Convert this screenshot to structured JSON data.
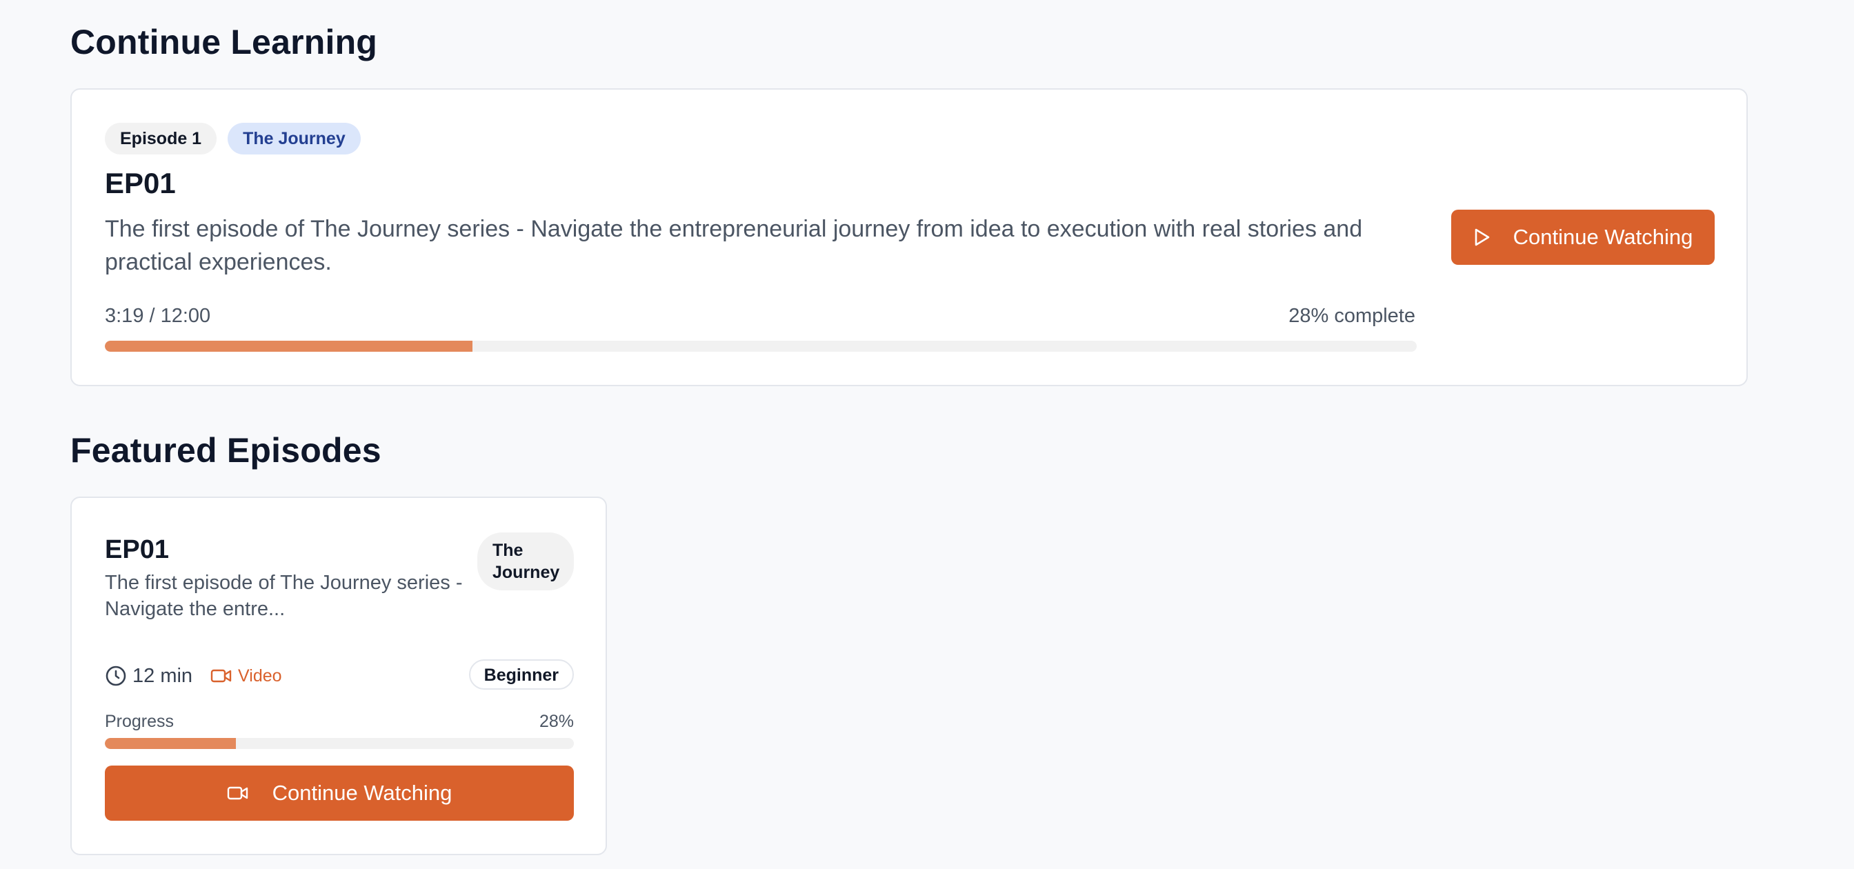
{
  "continue_learning": {
    "section_title": "Continue Learning",
    "episode_badge": "Episode 1",
    "series_badge": "The Journey",
    "episode_title": "EP01",
    "description": "The first episode of The Journey series - Navigate the entrepreneurial journey from idea to execution with real stories and practical experiences.",
    "time_progress": "3:19 / 12:00",
    "complete_text": "28% complete",
    "progress_fraction": 0.28,
    "button_label": "Continue Watching",
    "button_icon": "play-icon"
  },
  "featured_episodes": {
    "section_title": "Featured Episodes",
    "cards": [
      {
        "title": "EP01",
        "description": "The first episode of The Journey series - Navigate the entre...",
        "series_badge": "The Journey",
        "duration": "12 min",
        "duration_icon": "clock-icon",
        "type": "Video",
        "type_icon": "video-camera-icon",
        "level": "Beginner",
        "progress_label": "Progress",
        "progress_percent_text": "28%",
        "progress_fraction": 0.28,
        "button_label": "Continue Watching",
        "button_icon": "video-camera-icon"
      }
    ]
  },
  "colors": {
    "accent": "#d9612c",
    "progress_fill": "#e4895b",
    "progress_track": "#f1f1f1",
    "series_badge_bg": "#dbe6fb",
    "series_badge_text": "#233f91",
    "page_bg": "#f8f9fb"
  }
}
